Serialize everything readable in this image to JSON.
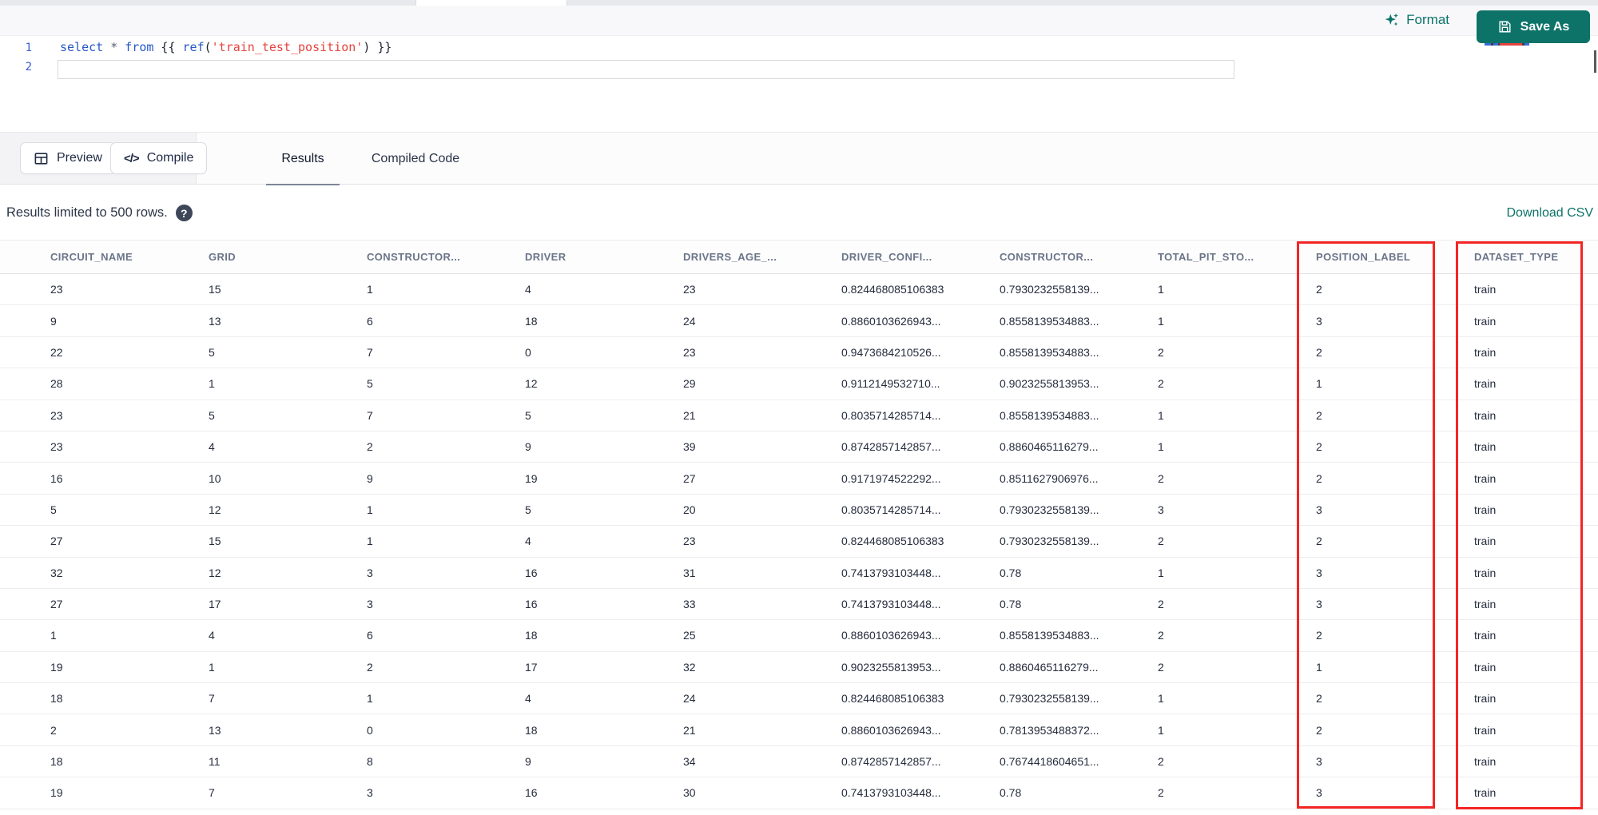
{
  "colors": {
    "teal_accent": "#0d7369",
    "red_annotation": "#f42525",
    "keyword_blue": "#2457c5",
    "string_red": "#e5433e"
  },
  "topbar": {
    "format_label": "Format",
    "save_as_label": "Save As"
  },
  "editor": {
    "lines": [
      {
        "number": "1"
      },
      {
        "number": "2"
      }
    ],
    "tokens": [
      {
        "t": "select",
        "c": "kw"
      },
      {
        "t": " ",
        "c": "plain"
      },
      {
        "t": "*",
        "c": "op"
      },
      {
        "t": " ",
        "c": "plain"
      },
      {
        "t": "from",
        "c": "kw"
      },
      {
        "t": " {{ ",
        "c": "plain"
      },
      {
        "t": "ref",
        "c": "kw"
      },
      {
        "t": "(",
        "c": "plain"
      },
      {
        "t": "'train_test_position'",
        "c": "str"
      },
      {
        "t": ")",
        "c": "plain"
      },
      {
        "t": " }}",
        "c": "plain"
      }
    ]
  },
  "toolbar": {
    "preview_label": "Preview",
    "compile_label": "Compile",
    "compile_glyph": "</>",
    "tabs": [
      {
        "label": "Results",
        "active": true
      },
      {
        "label": "Compiled Code",
        "active": false
      }
    ]
  },
  "results_bar": {
    "info": "Results limited to 500 rows.",
    "help_glyph": "?",
    "download_label": "Download CSV"
  },
  "table": {
    "columns": [
      "CIRCUIT_NAME",
      "GRID",
      "CONSTRUCTOR...",
      "DRIVER",
      "DRIVERS_AGE_...",
      "DRIVER_CONFI...",
      "CONSTRUCTOR...",
      "TOTAL_PIT_STO...",
      "POSITION_LABEL",
      "DATASET_TYPE"
    ],
    "highlighted_columns": [
      "POSITION_LABEL",
      "DATASET_TYPE"
    ],
    "rows": [
      [
        "23",
        "15",
        "1",
        "4",
        "23",
        "0.824468085106383",
        "0.7930232558139...",
        "1",
        "2",
        "train"
      ],
      [
        "9",
        "13",
        "6",
        "18",
        "24",
        "0.8860103626943...",
        "0.8558139534883...",
        "1",
        "3",
        "train"
      ],
      [
        "22",
        "5",
        "7",
        "0",
        "23",
        "0.9473684210526...",
        "0.8558139534883...",
        "2",
        "2",
        "train"
      ],
      [
        "28",
        "1",
        "5",
        "12",
        "29",
        "0.9112149532710...",
        "0.9023255813953...",
        "2",
        "1",
        "train"
      ],
      [
        "23",
        "5",
        "7",
        "5",
        "21",
        "0.8035714285714...",
        "0.8558139534883...",
        "1",
        "2",
        "train"
      ],
      [
        "23",
        "4",
        "2",
        "9",
        "39",
        "0.8742857142857...",
        "0.8860465116279...",
        "1",
        "2",
        "train"
      ],
      [
        "16",
        "10",
        "9",
        "19",
        "27",
        "0.9171974522292...",
        "0.8511627906976...",
        "2",
        "2",
        "train"
      ],
      [
        "5",
        "12",
        "1",
        "5",
        "20",
        "0.8035714285714...",
        "0.7930232558139...",
        "3",
        "3",
        "train"
      ],
      [
        "27",
        "15",
        "1",
        "4",
        "23",
        "0.824468085106383",
        "0.7930232558139...",
        "2",
        "2",
        "train"
      ],
      [
        "32",
        "12",
        "3",
        "16",
        "31",
        "0.7413793103448...",
        "0.78",
        "1",
        "3",
        "train"
      ],
      [
        "27",
        "17",
        "3",
        "16",
        "33",
        "0.7413793103448...",
        "0.78",
        "2",
        "3",
        "train"
      ],
      [
        "1",
        "4",
        "6",
        "18",
        "25",
        "0.8860103626943...",
        "0.8558139534883...",
        "2",
        "2",
        "train"
      ],
      [
        "19",
        "1",
        "2",
        "17",
        "32",
        "0.9023255813953...",
        "0.8860465116279...",
        "2",
        "1",
        "train"
      ],
      [
        "18",
        "7",
        "1",
        "4",
        "24",
        "0.824468085106383",
        "0.7930232558139...",
        "1",
        "2",
        "train"
      ],
      [
        "2",
        "13",
        "0",
        "18",
        "21",
        "0.8860103626943...",
        "0.7813953488372...",
        "1",
        "2",
        "train"
      ],
      [
        "18",
        "11",
        "8",
        "9",
        "34",
        "0.8742857142857...",
        "0.7674418604651...",
        "2",
        "3",
        "train"
      ],
      [
        "19",
        "7",
        "3",
        "16",
        "30",
        "0.7413793103448...",
        "0.78",
        "2",
        "3",
        "train"
      ]
    ]
  }
}
